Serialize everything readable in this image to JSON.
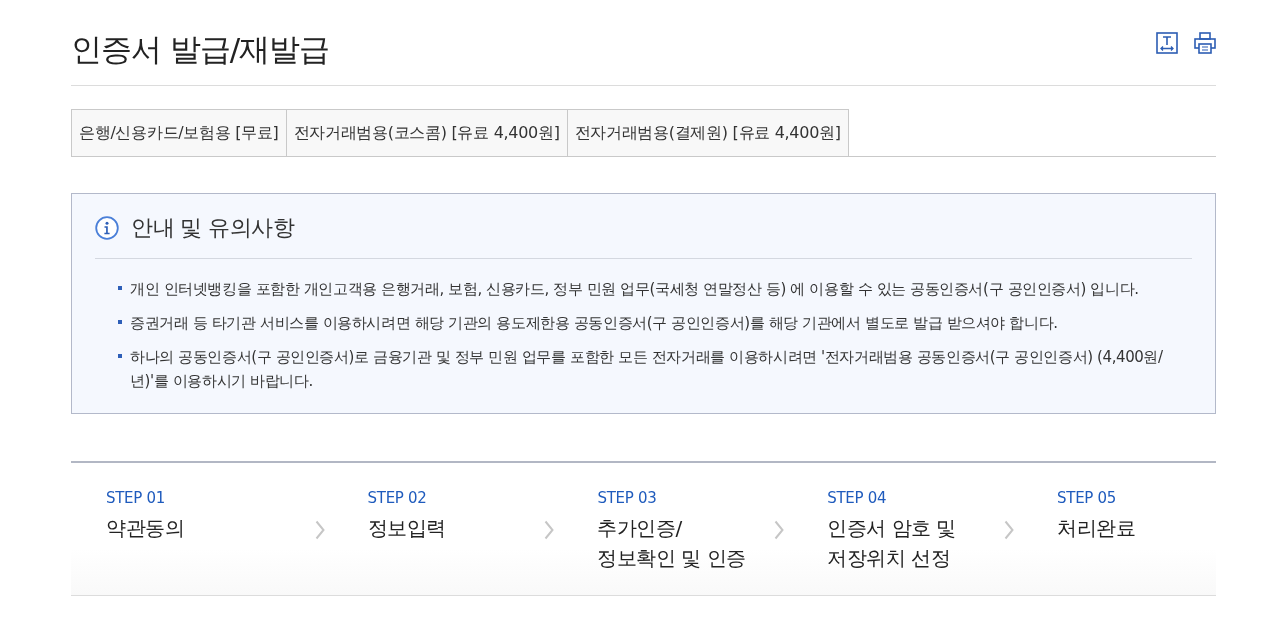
{
  "page_title": "인증서 발급/재발급",
  "tabs": [
    {
      "label": "은행/신용카드/보험용 [무료]"
    },
    {
      "label": "전자거래범용(코스콤) [유료 4,400원]"
    },
    {
      "label": "전자거래범용(결제원) [유료 4,400원]"
    }
  ],
  "notice": {
    "title": "안내 및 유의사항",
    "items": [
      "개인 인터넷뱅킹을 포함한 개인고객용 은행거래, 보험, 신용카드, 정부 민원 업무(국세청 연말정산 등) 에 이용할 수 있는 공동인증서(구 공인인증서) 입니다.",
      "증권거래 등 타기관 서비스를 이용하시려면 해당 기관의 용도제한용 공동인증서(구 공인인증서)를 해당 기관에서 별도로 발급 받으셔야 합니다.",
      "하나의 공동인증서(구 공인인증서)로 금융기관 및 정부 민원 업무를 포함한 모든 전자거래를 이용하시려면 '전자거래범용 공동인증서(구 공인인증서) (4,400원/년)'를 이용하시기 바랍니다."
    ]
  },
  "steps": [
    {
      "label": "STEP 01",
      "name": "약관동의"
    },
    {
      "label": "STEP 02",
      "name": "정보입력"
    },
    {
      "label": "STEP 03",
      "name": "추가인증/\n정보확인 및 인증"
    },
    {
      "label": "STEP 04",
      "name": "인증서 암호 및\n저장위치 선정"
    },
    {
      "label": "STEP 05",
      "name": "처리완료"
    }
  ]
}
